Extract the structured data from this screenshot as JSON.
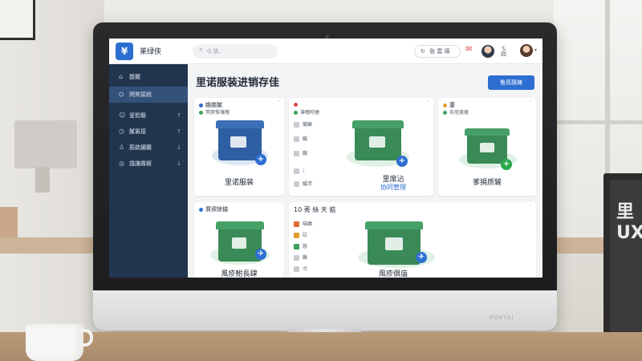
{
  "app": {
    "logo_glyph": "¥",
    "name": "莱绿侠",
    "search_placeholder": "Q 姚..",
    "top_action_label": "张 雲 墳",
    "top_action_icon": "refresh-icon",
    "mid_icon_label": "-L",
    "mid_icon_label2": "品"
  },
  "sidebar": {
    "items": [
      {
        "icon": "home-icon",
        "label": "馥麓",
        "active": false,
        "caret": ""
      },
      {
        "icon": "network-icon",
        "label": "鬨焦猿桃",
        "active": true,
        "caret": ""
      },
      {
        "icon": "user-icon",
        "label": "釜勠簸",
        "active": false,
        "caret": "↑"
      },
      {
        "icon": "clock-icon",
        "label": "膩氯接",
        "active": false,
        "caret": "↑"
      },
      {
        "icon": "person-icon",
        "label": "筋斂躪蘿",
        "active": false,
        "caret": "↓"
      },
      {
        "icon": "globe-icon",
        "label": "諷讒霧鏟",
        "active": false,
        "caret": "↓"
      }
    ]
  },
  "main": {
    "title": "里诺服装进销存佳",
    "primary_button": "鲁鬲猜擁",
    "cards": [
      {
        "head": "趣膝膩",
        "sub": "冥俯惟壤槐",
        "caption": "里诺服装",
        "caption2": "",
        "color": "#2f5fa3",
        "badge": "+",
        "badge_color": "#2d6fd1"
      },
      {
        "head": "",
        "sub": "凍槐咆捷",
        "caption": "里席沾",
        "caption2": "协同管理",
        "color": "#3a8a58",
        "badge": "+",
        "badge_color": "#2d6fd1",
        "rows": [
          "鸞齦",
          "饞",
          "饞",
          "冫",
          "醞沛"
        ]
      },
      {
        "head": "萋",
        "sub": "条痊羹薩",
        "caption": "爹捐质鏟",
        "caption2": "",
        "color": "#3a8a58",
        "badge": "+",
        "badge_color": "#2aa84a"
      },
      {
        "head": "屑锲掠錨",
        "sub": "",
        "caption": "風疹鮒長肆",
        "caption2": "",
        "color": "#3a8a58",
        "badge": "✈",
        "badge_color": "#2d6fd1"
      },
      {
        "head": "10 莠 絲 天 掂",
        "sub": "",
        "caption": "風疹俱庙",
        "caption2": "",
        "color": "#3a8a58",
        "badge": "✈",
        "badge_color": "#2d6fd1",
        "rows": [
          "喵磨",
          "砬",
          "慈",
          "雞",
          "弌"
        ]
      }
    ]
  },
  "scene": {
    "chin_brand": "POXYAI",
    "side_device_text": "里\nUX"
  }
}
